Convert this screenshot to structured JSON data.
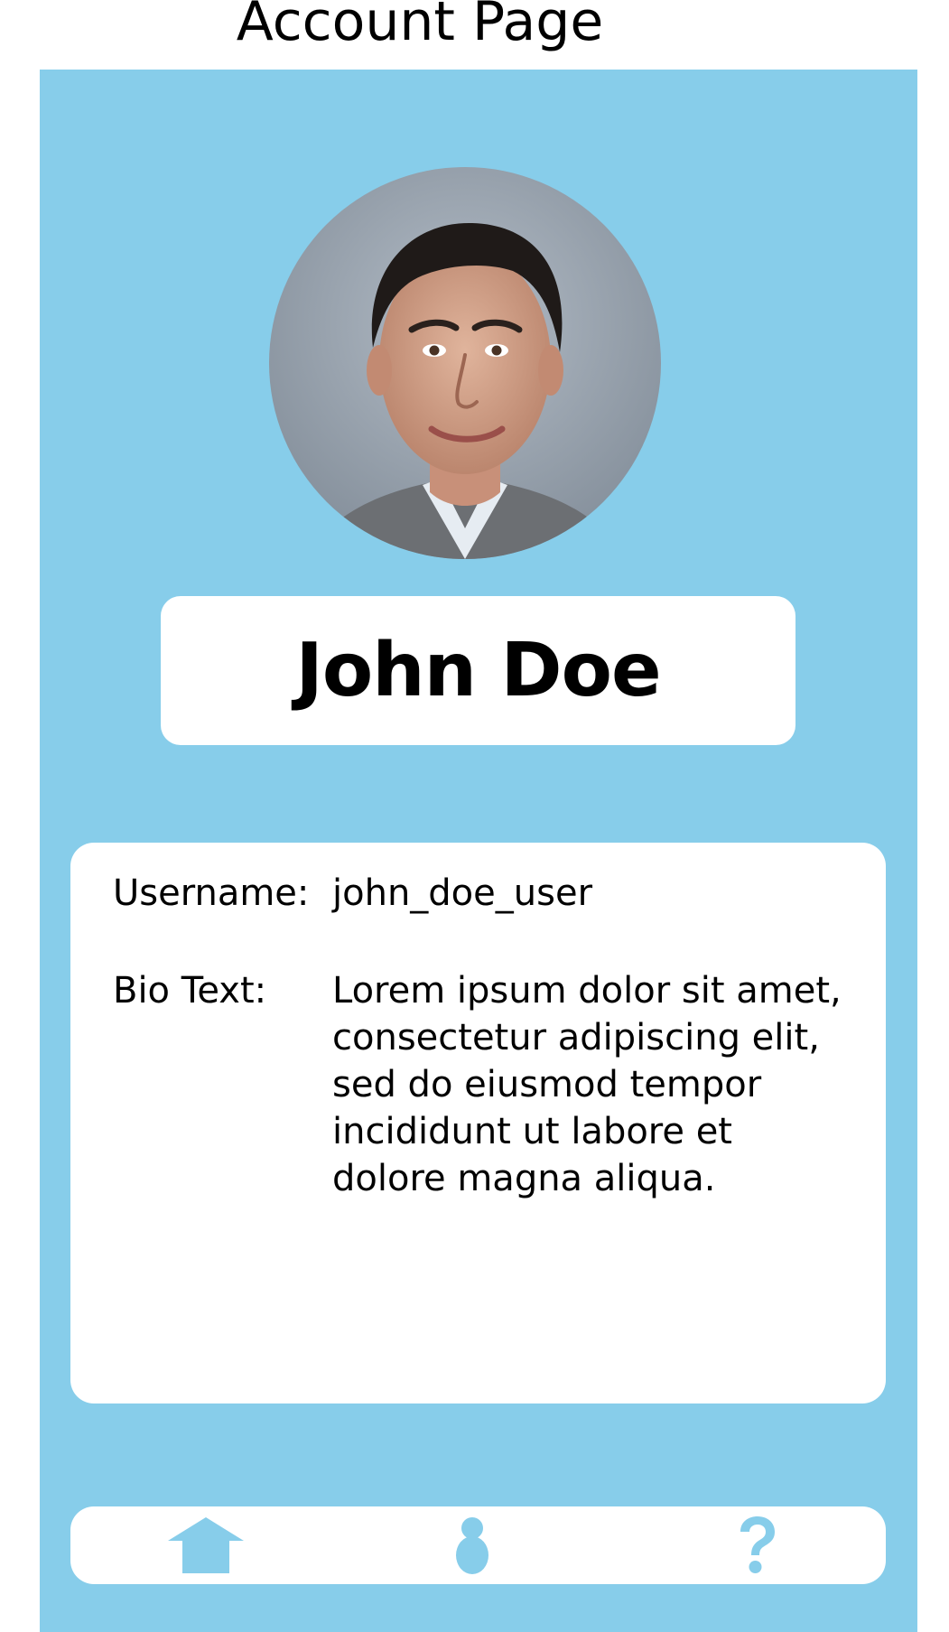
{
  "header": {
    "title": "Account Page"
  },
  "profile": {
    "name": "John Doe",
    "avatar_icon": "profile-photo"
  },
  "details": {
    "username_label": "Username:",
    "username_value": "john_doe_user",
    "bio_label": "Bio Text:",
    "bio_value": "Lorem ipsum dolor sit amet, consectetur adipiscing elit, sed do eiusmod tempor incididunt ut labore et dolore magna aliqua."
  },
  "nav": {
    "items": [
      {
        "icon": "home-icon"
      },
      {
        "icon": "profile-icon"
      },
      {
        "icon": "help-icon"
      }
    ]
  },
  "colors": {
    "background": "#87cdea",
    "card": "#ffffff",
    "icon": "#87cdea",
    "text": "#000000"
  }
}
